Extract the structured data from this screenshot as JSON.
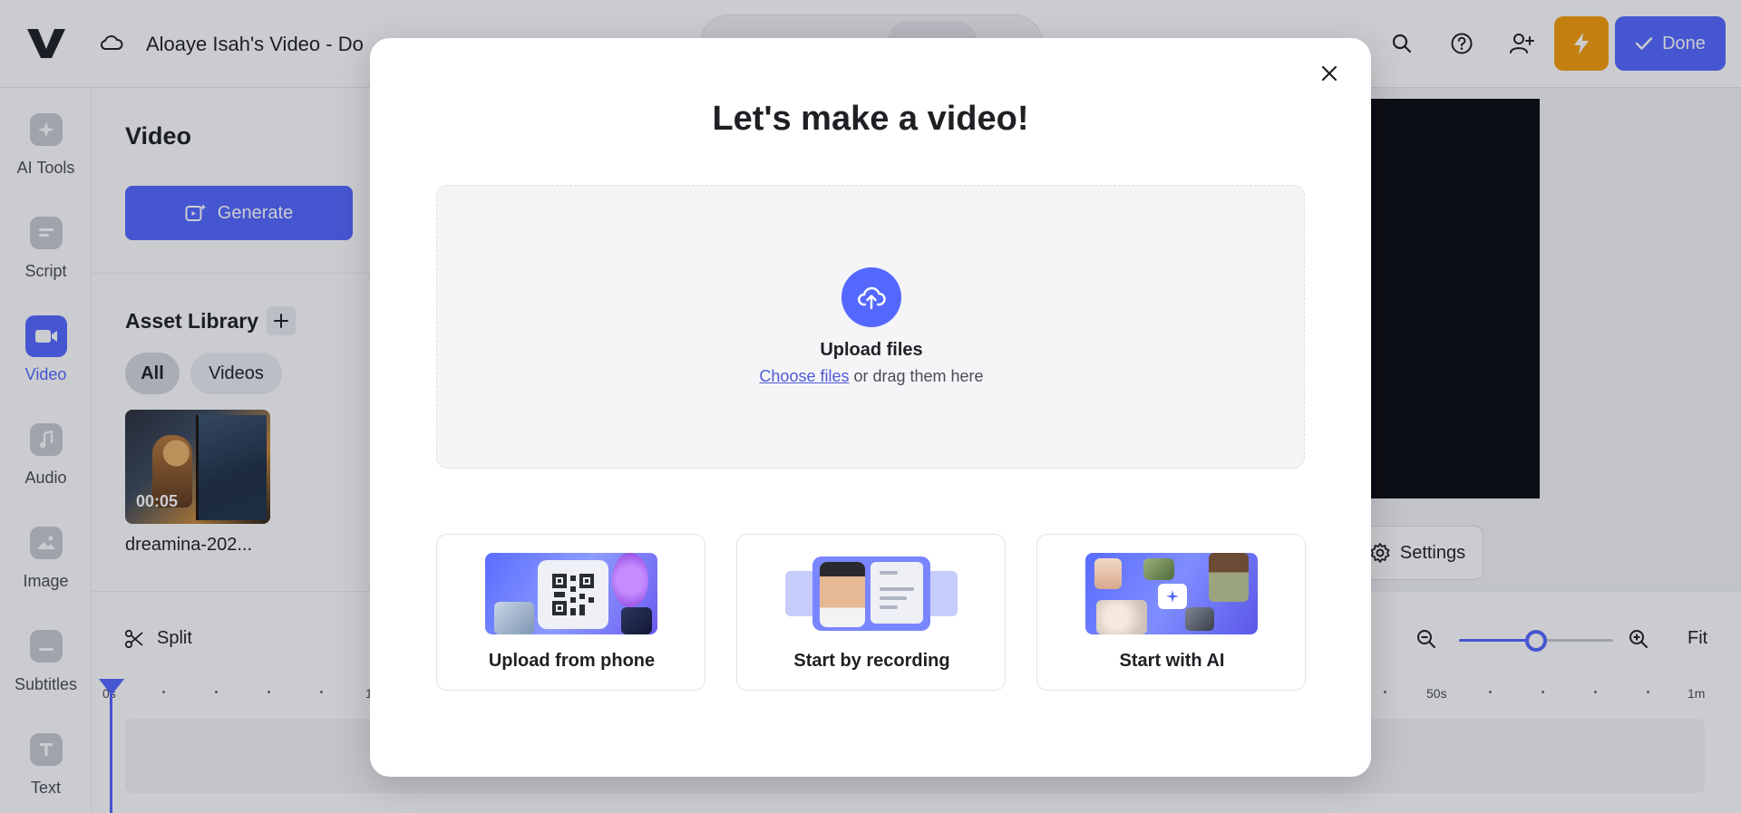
{
  "header": {
    "project_title": "Aloaye Isah's Video - Do",
    "done_label": "Done"
  },
  "rail": {
    "items": [
      {
        "label": "AI Tools",
        "icon": "sparkle-icon"
      },
      {
        "label": "Script",
        "icon": "script-icon"
      },
      {
        "label": "Video",
        "icon": "video-camera-icon"
      },
      {
        "label": "Audio",
        "icon": "music-note-icon"
      },
      {
        "label": "Image",
        "icon": "image-icon"
      },
      {
        "label": "Subtitles",
        "icon": "subtitles-icon"
      },
      {
        "label": "Text",
        "icon": "text-icon"
      }
    ],
    "active": "Video"
  },
  "panel": {
    "title": "Video",
    "generate_label": "Generate",
    "asset_library_title": "Asset Library",
    "filters": [
      "All",
      "Videos"
    ],
    "active_filter": "All",
    "assets": [
      {
        "name": "dreamina-202...",
        "duration": "00:05"
      }
    ]
  },
  "preview": {
    "settings_label": "Settings"
  },
  "timeline": {
    "split_label": "Split",
    "fit_label": "Fit",
    "zoom_level": 0.5,
    "ruler_labels": {
      "start": "0s",
      "mid": "1",
      "fifty": "50s",
      "end": "1m"
    }
  },
  "modal": {
    "title": "Let's make a video!",
    "upload_title": "Upload files",
    "choose_files": "Choose files",
    "drag_text": " or drag them here",
    "options": [
      {
        "label": "Upload from phone"
      },
      {
        "label": "Start by recording"
      },
      {
        "label": "Start with AI"
      }
    ]
  },
  "colors": {
    "accent": "#5468ff",
    "bolt": "#f59e0b",
    "video_canvas": "#0c0d11"
  }
}
